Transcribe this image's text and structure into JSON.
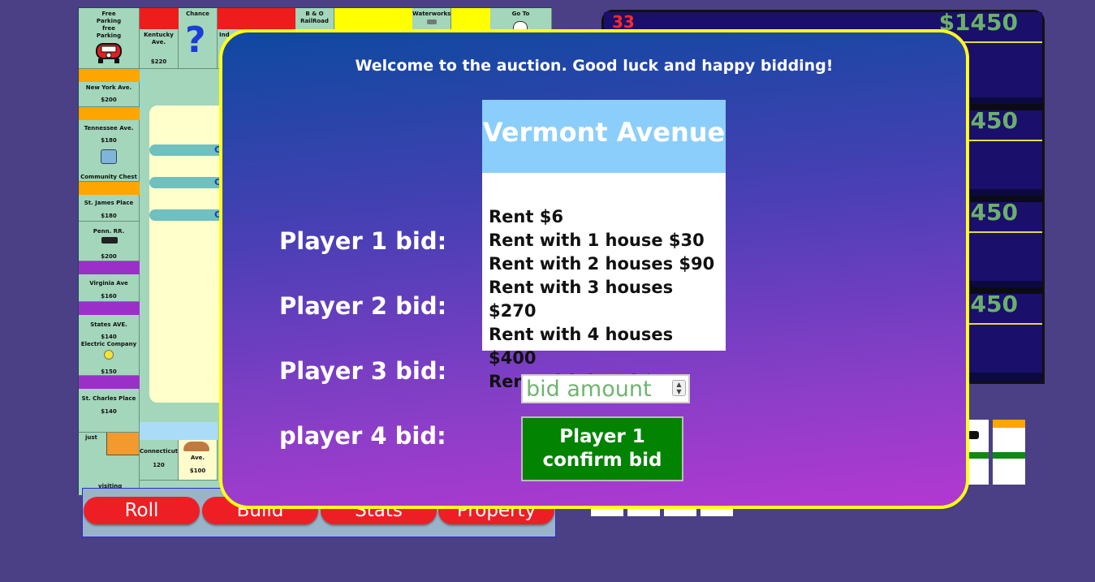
{
  "board": {
    "top_row": [
      {
        "name": "Free Parking free Parking",
        "price": ""
      },
      {
        "name": "Kentucky Ave.",
        "price": "$220"
      },
      {
        "name": "Chance",
        "price": ""
      },
      {
        "name": "Ind",
        "price": ""
      },
      {
        "name": "B & O RailRoad",
        "price": ""
      },
      {
        "name": "Waterworks",
        "price": ""
      },
      {
        "name": "Go To",
        "price": ""
      }
    ],
    "left_column": [
      {
        "name": "New York Ave.",
        "price": "$200"
      },
      {
        "name": "Tennessee Ave.",
        "price": "$180"
      },
      {
        "name": "Community Chest",
        "price": ""
      },
      {
        "name": "St. James Place",
        "price": "$180"
      },
      {
        "name": "Penn. RR.",
        "price": "$200"
      },
      {
        "name": "Virginia Ave",
        "price": "$160"
      },
      {
        "name": "States AVE.",
        "price": "$140"
      },
      {
        "name": "Electric Company",
        "price": "$150"
      },
      {
        "name": "St. Charles Place",
        "price": "$140"
      }
    ],
    "corner_jail": {
      "just": "just",
      "visiting": "visiting"
    },
    "bottom_row": [
      {
        "name": "Connecticut",
        "price": "120"
      },
      {
        "name": "Ave.",
        "price": "$100"
      }
    ],
    "center_pills": [
      "C",
      "C",
      "C"
    ],
    "chance_symbol": "?"
  },
  "actions": {
    "roll": "Roll",
    "build": "Build",
    "stats": "Stats",
    "property": "Property"
  },
  "players_panel": {
    "money": [
      "$1450",
      "$1450",
      "$1450",
      "$1450"
    ],
    "first_name": "33"
  },
  "auction": {
    "welcome": "Welcome to the auction. Good luck and happy bidding!",
    "bid_labels": [
      "Player 1 bid:",
      "Player 2 bid:",
      "Player 3 bid:",
      "player 4 bid:"
    ],
    "property": {
      "name": "Vermont Avenue",
      "color": "#8ccefb",
      "rents": [
        "Rent $6",
        "Rent with 1 house $30",
        "Rent with 2 houses $90",
        "Rent with 3 houses $270",
        "Rent with 4 houses $400",
        "Rent with hotel $550"
      ]
    },
    "bid_placeholder": "bid amount",
    "confirm_line1": "Player 1",
    "confirm_line2": "confirm bid"
  },
  "colors": {
    "background": "#4b3f86",
    "modal_border": "#ffff18",
    "confirm_button": "#028302",
    "action_button": "#ee1f24",
    "money_text": "#6ab06a"
  }
}
